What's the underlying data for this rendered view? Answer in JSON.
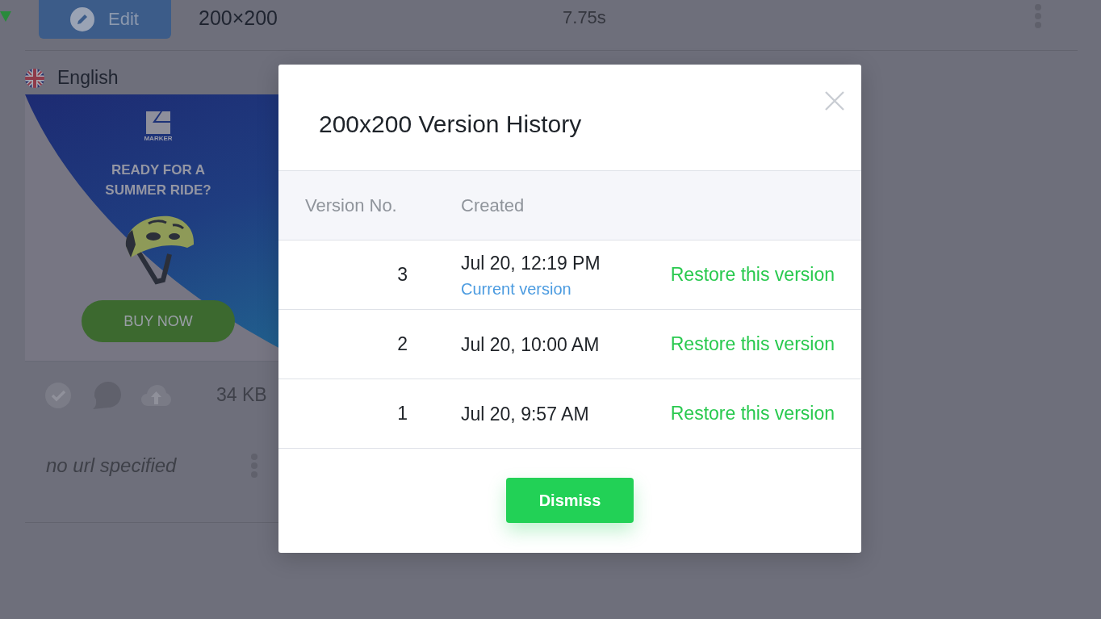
{
  "file_row": {
    "edit_button": "Edit",
    "dimensions": "200×200",
    "duration": "7.75s"
  },
  "language": {
    "name": "English"
  },
  "banner": {
    "brand": "MARKER",
    "headline": "READY FOR A SUMMER RIDE?",
    "cta": "BUY NOW"
  },
  "asset": {
    "size": "34 KB",
    "url": "no url specified"
  },
  "modal": {
    "title": "200x200 Version History",
    "columns": [
      "Version No.",
      "Created"
    ],
    "rows": [
      {
        "version": "3",
        "created": "Jul 20, 12:19 PM",
        "note": "Current version",
        "action": "Restore this version"
      },
      {
        "version": "2",
        "created": "Jul 20, 10:00 AM",
        "action": "Restore this version"
      },
      {
        "version": "1",
        "created": "Jul 20, 9:57 AM",
        "action": "Restore this version"
      }
    ],
    "dismiss": "Dismiss"
  }
}
